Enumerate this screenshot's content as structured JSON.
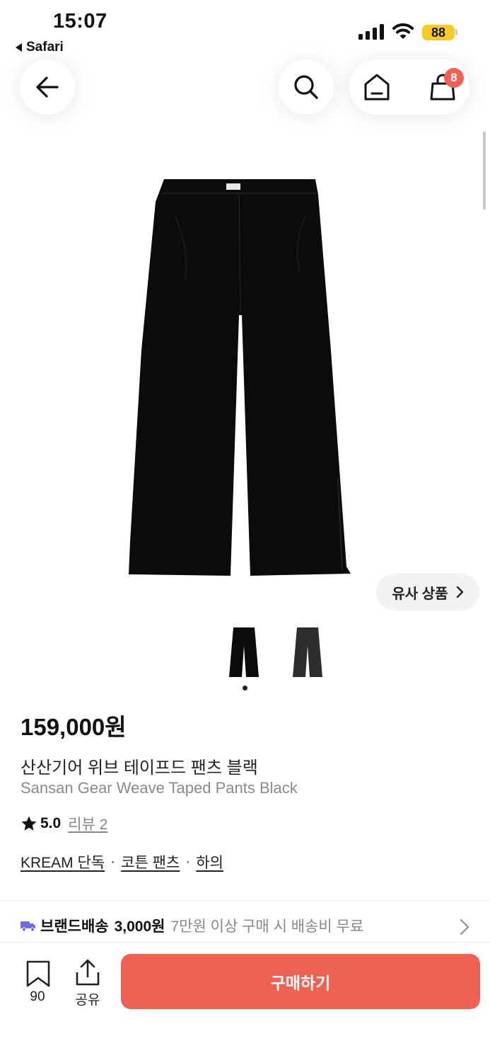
{
  "status_bar": {
    "time": "15:07",
    "back_app": "Safari",
    "battery": "88",
    "battery_color": "#f5cc26"
  },
  "header": {
    "back_icon": "arrow-left-icon",
    "search_icon": "search-icon",
    "home_icon": "home-icon",
    "cart_icon": "shopping-bag-icon",
    "cart_badge": "8",
    "badge_color": "#ef6253"
  },
  "gallery": {
    "similar_label": "유사 상품",
    "thumbnails": [
      "black-pants-thumbnail",
      "charcoal-pants-thumbnail"
    ],
    "active_index": 0
  },
  "product": {
    "price": "159,000원",
    "name_ko": "산산기어 위브 테이프드 팬츠 블랙",
    "name_en": "Sansan Gear Weave Taped Pants Black",
    "rating": "5.0",
    "reviews_label": "리뷰 2",
    "tags": [
      "KREAM 단독",
      "코튼 팬츠",
      "하의"
    ],
    "tag_separator": "·"
  },
  "shipping": {
    "label": "브랜드배송",
    "fee": "3,000원",
    "note": "7만원 이상 구매 시 배송비 무료"
  },
  "bottom_bar": {
    "bookmark_count": "90",
    "share_label": "공유",
    "buy_label": "구매하기",
    "accent": "#ef6253"
  }
}
